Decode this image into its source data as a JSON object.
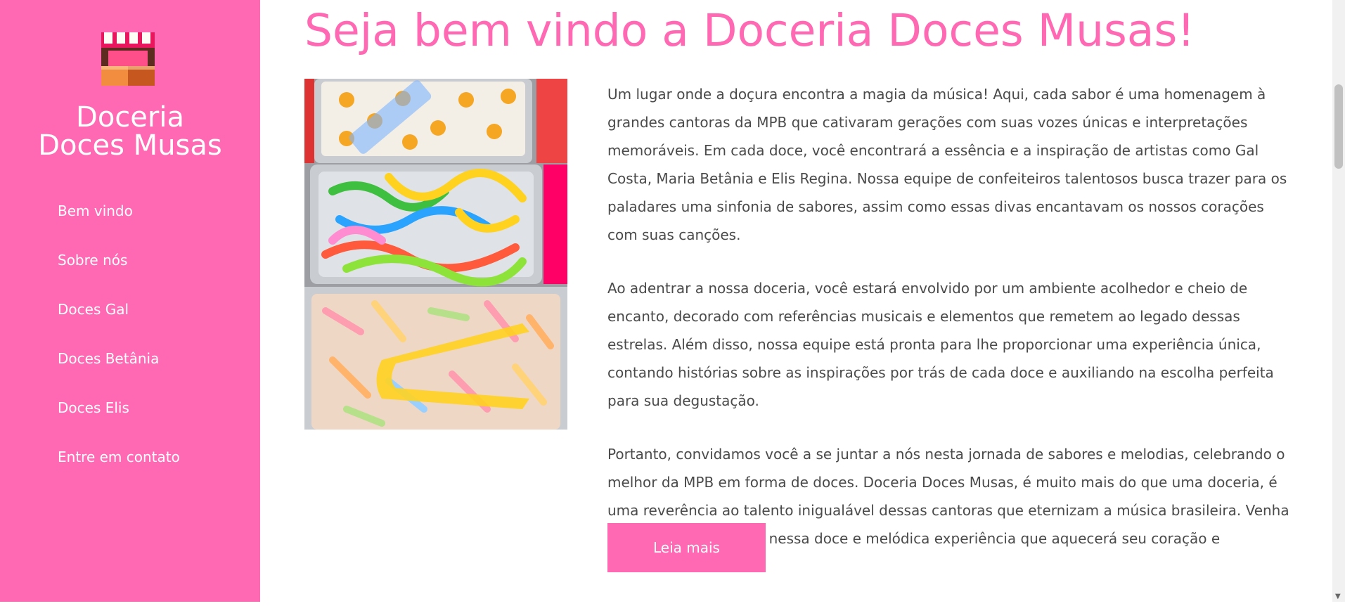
{
  "brand": {
    "line1": "Doceria",
    "line2": "Doces Musas",
    "logo_icon": "candy-shop-icon"
  },
  "nav": [
    {
      "label": "Bem vindo"
    },
    {
      "label": "Sobre nós"
    },
    {
      "label": "Doces Gal"
    },
    {
      "label": "Doces Betânia"
    },
    {
      "label": "Doces Elis"
    },
    {
      "label": "Entre em contato"
    }
  ],
  "main": {
    "title": "Seja bem vindo a Doceria Doces Musas!",
    "paragraphs": [
      "Um lugar onde a doçura encontra a magia da música! Aqui, cada sabor é uma homenagem à grandes cantoras da MPB que cativaram gerações com suas vozes únicas e interpretações memoráveis. Em cada doce, você encontrará a essência e a inspiração de artistas como Gal Costa, Maria Betânia e Elis Regina. Nossa equipe de confeiteiros talentosos busca trazer para os paladares uma sinfonia de sabores, assim como essas divas encantavam os nossos corações com suas canções.",
      "Ao adentrar a nossa doceria, você estará envolvido por um ambiente acolhedor e cheio de encanto, decorado com referências musicais e elementos que remetem ao legado dessas estrelas. Além disso, nossa equipe está pronta para lhe proporcionar uma experiência única, contando histórias sobre as inspirações por trás de cada doce e auxiliando na escolha perfeita para sua degustação.",
      "Portanto, convidamos você a se juntar a nós nesta jornada de sabores e melodias, celebrando o melhor da MPB em forma de doces. Doceria Doces Musas, é muito mais do que uma doceria, é uma reverência ao talento inigualável dessas cantoras que eternizam a música brasileira. Venha se deliciar e embarcar nessa doce e melódica experiência que aquecerá seu coração e alimentará sua alma!"
    ],
    "button_label": "Leia mais"
  },
  "colors": {
    "accent": "#ff69b4",
    "text": "#4a4a4a",
    "background": "#ffffff"
  }
}
